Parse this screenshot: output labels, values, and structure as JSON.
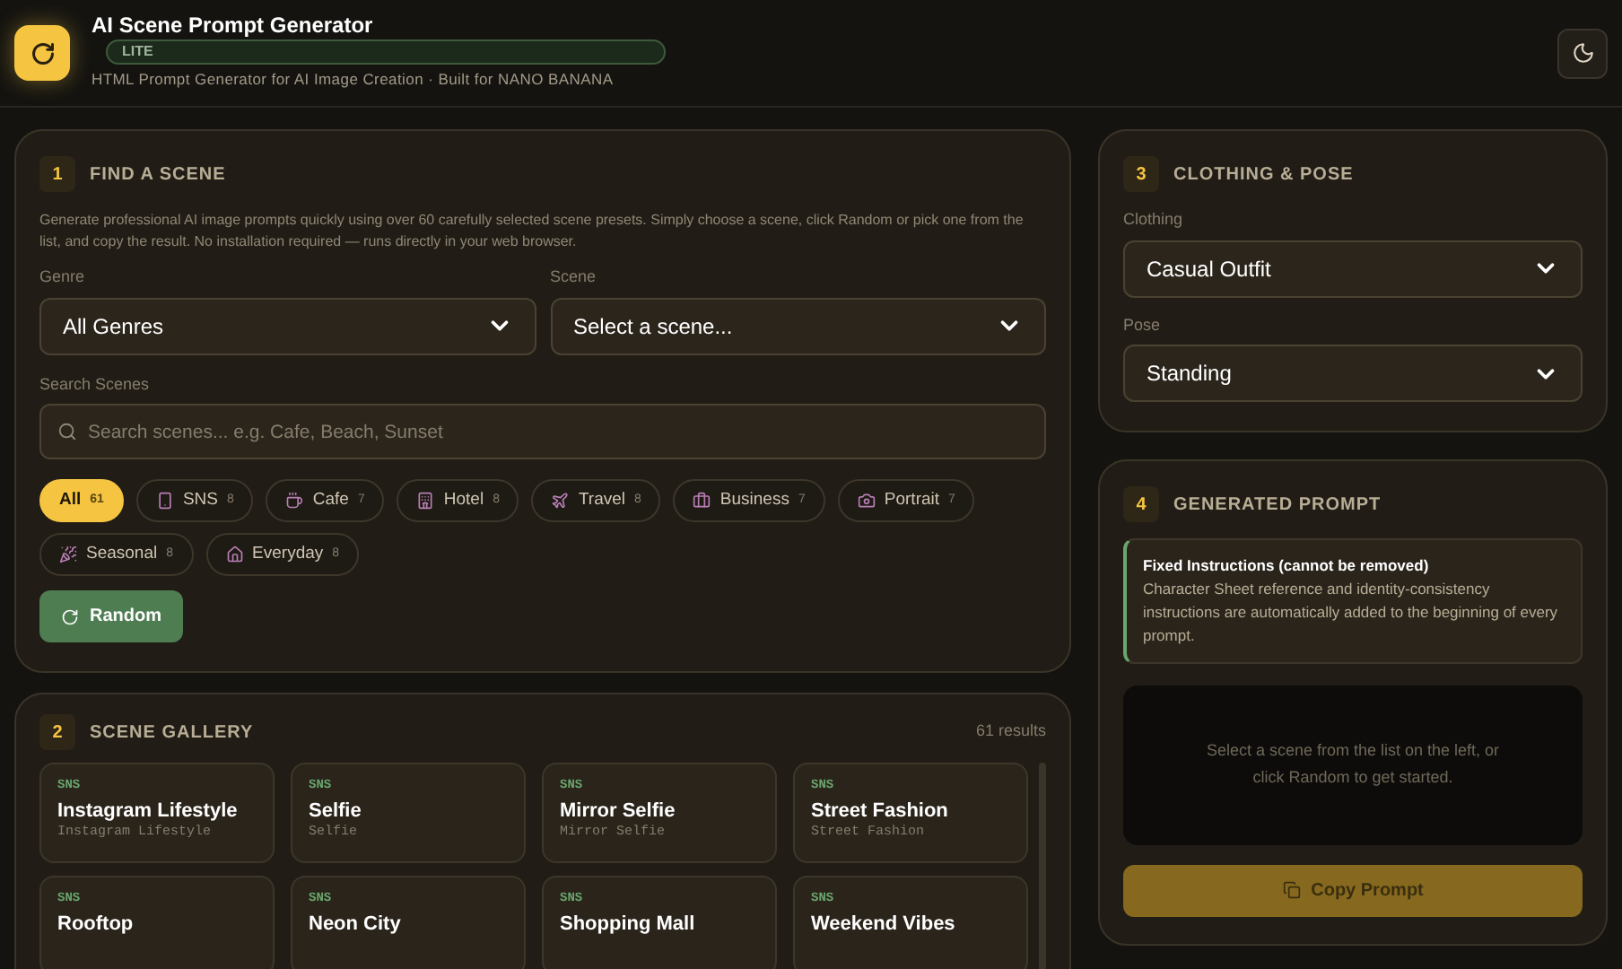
{
  "header": {
    "title": "AI Scene Prompt Generator",
    "badge": "LITE",
    "subtitle": "HTML Prompt Generator for AI Image Creation · Built for NANO BANANA"
  },
  "find_scene": {
    "number": "1",
    "title": "FIND A SCENE",
    "description": "Generate professional AI image prompts quickly using over 60 carefully selected scene presets. Simply choose a scene, click Random or pick one from the list, and copy the result. No installation required — runs directly in your web browser.",
    "genre": {
      "label": "Genre",
      "value": "All Genres"
    },
    "scene": {
      "label": "Scene",
      "value": "Select a scene..."
    },
    "search": {
      "label": "Search Scenes",
      "placeholder": "Search scenes... e.g. Cafe, Beach, Sunset"
    },
    "chips": [
      {
        "label": "All",
        "count": "61",
        "selected": true
      },
      {
        "label": "SNS",
        "count": "8",
        "selected": false
      },
      {
        "label": "Cafe",
        "count": "7",
        "selected": false
      },
      {
        "label": "Hotel",
        "count": "8",
        "selected": false
      },
      {
        "label": "Travel",
        "count": "8",
        "selected": false
      },
      {
        "label": "Business",
        "count": "7",
        "selected": false
      },
      {
        "label": "Portrait",
        "count": "7",
        "selected": false
      },
      {
        "label": "Seasonal",
        "count": "8",
        "selected": false
      },
      {
        "label": "Everyday",
        "count": "8",
        "selected": false
      }
    ],
    "random_button": "Random"
  },
  "gallery": {
    "number": "2",
    "title": "SCENE GALLERY",
    "results": "61 results",
    "cards": [
      {
        "tag": "SNS",
        "title": "Instagram Lifestyle",
        "subtitle": "Instagram Lifestyle"
      },
      {
        "tag": "SNS",
        "title": "Selfie",
        "subtitle": "Selfie"
      },
      {
        "tag": "SNS",
        "title": "Mirror Selfie",
        "subtitle": "Mirror Selfie"
      },
      {
        "tag": "SNS",
        "title": "Street Fashion",
        "subtitle": "Street Fashion"
      },
      {
        "tag": "SNS",
        "title": "Rooftop"
      },
      {
        "tag": "SNS",
        "title": "Neon City"
      },
      {
        "tag": "SNS",
        "title": "Shopping Mall"
      },
      {
        "tag": "SNS",
        "title": "Weekend Vibes"
      }
    ]
  },
  "clothing_pose": {
    "number": "3",
    "title": "CLOTHING & POSE",
    "clothing": {
      "label": "Clothing",
      "value": "Casual Outfit"
    },
    "pose": {
      "label": "Pose",
      "value": "Standing"
    }
  },
  "generated_prompt": {
    "number": "4",
    "title": "GENERATED PROMPT",
    "notice": {
      "title": "Fixed Instructions (cannot be removed)",
      "text": "Character Sheet reference and identity-consistency instructions are automatically added to the beginning of every prompt."
    },
    "empty_text": "Select a scene from the list on the left, or click Random to get started.",
    "copy_button": {
      "label": "Copy Prompt",
      "disabled": true
    }
  }
}
